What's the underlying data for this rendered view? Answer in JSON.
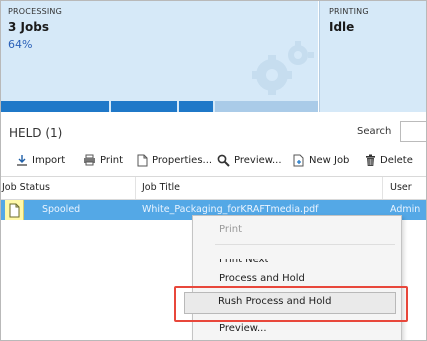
{
  "status": {
    "processing": {
      "label": "PROCESSING",
      "jobs": "3 Jobs",
      "percent": "64%",
      "progress_fraction": 0.64
    },
    "printing": {
      "label": "PRINTING",
      "state": "Idle"
    }
  },
  "held": {
    "title": "HELD (1)"
  },
  "search": {
    "label": "Search",
    "value": ""
  },
  "toolbar": {
    "import": "Import",
    "print": "Print",
    "properties": "Properties...",
    "preview": "Preview...",
    "new_job": "New Job",
    "delete": "Delete"
  },
  "table": {
    "columns": [
      "Job Status",
      "Job Title",
      "User"
    ],
    "rows": [
      {
        "status": "Spooled",
        "title": "White_Packaging_forKRAFTmedia.pdf",
        "user": "Admin"
      }
    ]
  },
  "context_menu": {
    "items": [
      "Print",
      "Print Next",
      "Process and Hold",
      "Rush Process and Hold",
      "Preview..."
    ],
    "highlighted": "Rush Process and Hold"
  },
  "colors": {
    "accent": "#1f78c8",
    "panel": "#d6e9f8",
    "selected_row": "#54a8e6",
    "highlight": "#e8473b"
  }
}
